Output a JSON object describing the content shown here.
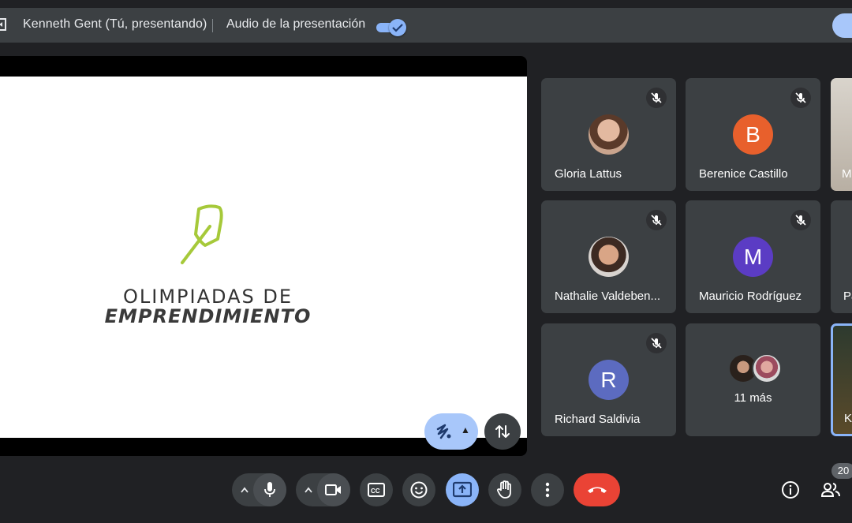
{
  "top_bar": {
    "presenter_label": "Kenneth Gent (Tú, presentando)",
    "audio_label": "Audio de la presentación",
    "audio_enabled": true
  },
  "slide": {
    "line1": "OLIMPIADAS DE",
    "line2": "EMPRENDIMIENTO",
    "logo_color": "#a6c93a"
  },
  "participants": [
    {
      "name": "Gloria Lattus",
      "avatar": "photo",
      "muted": true
    },
    {
      "name": "Berenice Castillo",
      "avatar_letter": "B",
      "avatar_color": "#e8602c",
      "muted": true
    },
    {
      "name": "Nathalie Valdeben...",
      "avatar": "photo",
      "muted": true
    },
    {
      "name": "Mauricio Rodríguez",
      "avatar_letter": "M",
      "avatar_color": "#5b3cc4",
      "muted": true
    },
    {
      "name": "Richard Saldivia",
      "avatar_letter": "R",
      "avatar_color": "#5c6bc0",
      "muted": true
    }
  ],
  "more_tile": {
    "label": "11 más"
  },
  "partial_tiles": [
    {
      "label": "M"
    },
    {
      "label": "Pa"
    },
    {
      "label": "Ke"
    }
  ],
  "toolbar": {
    "people_count": "20"
  },
  "colors": {
    "background": "#202124",
    "surface": "#3c4043",
    "accent": "#8ab4f8",
    "end_call": "#ea4335"
  }
}
